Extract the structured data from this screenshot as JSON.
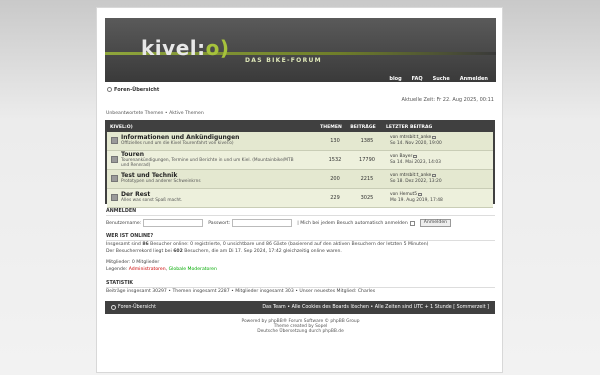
{
  "header": {
    "logo_text": "kivel:",
    "logo_bracket": "o)",
    "tagline": "DAS BIKE-FORUM",
    "nav": [
      "blog",
      "FAQ",
      "Suche",
      "Anmelden"
    ]
  },
  "breadcrumb": "Foren-Übersicht",
  "current_time": "Aktuelle Zeit: Fr 22. Aug 2025, 00:11",
  "quicklinks": "Unbeantwortete Themen • Aktive Themen",
  "forum_table": {
    "columns": [
      "KIVEL:O)",
      "THEMEN",
      "BEITRÄGE",
      "LETZTER BEITRAG"
    ],
    "rows": [
      {
        "title": "Informationen und Ankündigungen",
        "desc": [
          "Offizielles rund um die Kivel Tourenfahrt von kivel:o)"
        ],
        "topics": "130",
        "posts": "1385",
        "last_by": "von mtrsbit:t_anke",
        "last_date": "So 14. Nov 2020, 19:00"
      },
      {
        "title": "Touren",
        "desc": [
          "Tourenankündigungen, Termine und Berichte in und um Kiel. (Mountainbike/MTB",
          "und Rennrad)"
        ],
        "topics": "1532",
        "posts": "17790",
        "last_by": "von Bayer",
        "last_date": "Sa 14. Mai 2023, 14:03"
      },
      {
        "title": "Test und Technik",
        "desc": [
          "Prototypen und anderer Schweinkrns"
        ],
        "topics": "200",
        "posts": "2215",
        "last_by": "von mtrsbit:t_anke",
        "last_date": "So 18. Dez 2022, 13:20"
      },
      {
        "title": "Der Rest",
        "desc": [
          "Alles was sonst Spaß macht."
        ],
        "topics": "229",
        "posts": "3025",
        "last_by": "von Hemut5",
        "last_date": "Mo 19. Aug 2019, 17:48"
      }
    ]
  },
  "login": {
    "title": "ANMELDEN",
    "username_label": "Benutzername:",
    "password_label": "Passwort:",
    "remember_label": "| Mich bei jedem Besuch automatisch anmelden",
    "submit_label": "Anmelden"
  },
  "online": {
    "title": "WER IST ONLINE?",
    "line1_a": "Insgesamt sind ",
    "line1_b": "86",
    "line1_c": " Besucher online: 0 registrierte, 0 unsichtbare und 86 Gäste (basierend auf den aktiven Besuchern der letzten 5 Minuten)",
    "line2_a": "Der Besucherrekord liegt bei ",
    "line2_b": "602",
    "line2_c": " Besuchern, die am Di 17. Sep 2024, 17:42 gleichzeitig online waren.",
    "members_line": "Mitglieder: 0 Mitglieder",
    "legend_label": "Legende: ",
    "legend_admin": "Administratoren",
    "legend_sep": ", ",
    "legend_mod": "Globale Moderatoren"
  },
  "stats": {
    "title": "STATISTIK",
    "line": "Beiträge insgesamt 30297 • Themen insgesamt 2287 • Mitglieder insgesamt 303 • Unser neuestes Mitglied: Charles"
  },
  "footer": {
    "home": "Foren-Übersicht",
    "right": "Das Team • Alle Cookies des Boards löschen • Alle Zeiten sind UTC + 1 Stunde [ Sommerzeit ]"
  },
  "copyright": [
    "Powered by phpBB® Forum Software © phpBB Group",
    "Theme created by Sopel",
    "Deutsche Übersetzung durch phpBB.de"
  ]
}
